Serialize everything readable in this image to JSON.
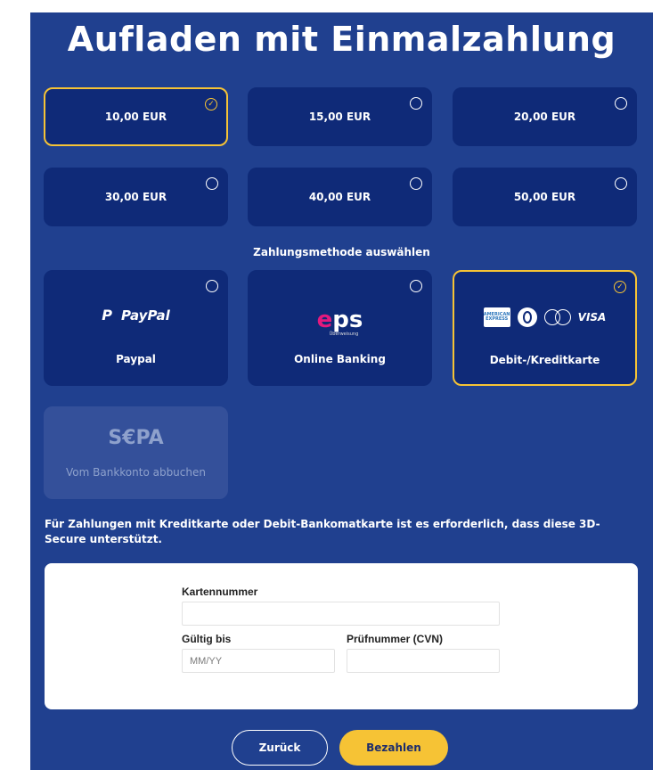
{
  "title": "Aufladen mit Einmalzahlung",
  "amounts": [
    {
      "label": "10,00 EUR",
      "selected": true
    },
    {
      "label": "15,00 EUR",
      "selected": false
    },
    {
      "label": "20,00 EUR",
      "selected": false
    },
    {
      "label": "30,00 EUR",
      "selected": false
    },
    {
      "label": "40,00 EUR",
      "selected": false
    },
    {
      "label": "50,00 EUR",
      "selected": false
    }
  ],
  "payment_section_label": "Zahlungsmethode auswählen",
  "methods": [
    {
      "label": "Paypal",
      "logo_text": "PayPal",
      "logo_icon": "paypal-logo-icon",
      "selected": false
    },
    {
      "label": "Online Banking",
      "logo_text": "eps",
      "logo_subtext": "Überweisung",
      "logo_icon": "eps-logo-icon",
      "selected": false
    },
    {
      "label": "Debit-/Kreditkarte",
      "logo_amex": "AMERICAN EXPRESS",
      "logo_visa": "VISA",
      "logo_icon": "card-logos-icon",
      "selected": true
    },
    {
      "label": "Vom Bankkonto abbuchen",
      "logo_text": "S€PA",
      "logo_icon": "sepa-logo-icon",
      "disabled": true
    }
  ],
  "note": "Für Zahlungen mit Kreditkarte oder Debit-Bankomatkarte ist es erforderlich, dass diese 3D-Secure unterstützt.",
  "form": {
    "card_number_label": "Kartennummer",
    "card_number_value": "",
    "valid_until_label": "Gültig bis",
    "valid_until_placeholder": "MM/YY",
    "cvn_label": "Prüfnummer (CVN)",
    "cvn_value": ""
  },
  "buttons": {
    "back_label": "Zurück",
    "pay_label": "Bezahlen"
  },
  "colors": {
    "background": "#20408f",
    "tile": "#0f2a78",
    "accent": "#f6c335",
    "disabled_tile": "#34509a"
  }
}
